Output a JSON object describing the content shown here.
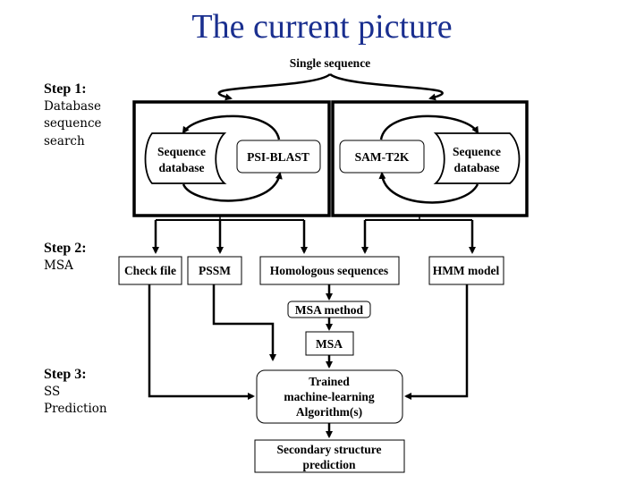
{
  "title": "The current picture",
  "steps": [
    {
      "heading": "Step 1:",
      "lines": [
        "Database",
        "sequence",
        "search"
      ]
    },
    {
      "heading": "Step 2:",
      "lines": [
        "MSA"
      ]
    },
    {
      "heading": "Step 3:",
      "lines": [
        "SS",
        "Prediction"
      ]
    }
  ],
  "diagram": {
    "input": "Single sequence",
    "left_panel": {
      "database": [
        "Sequence",
        "database"
      ],
      "tool": "PSI-BLAST"
    },
    "right_panel": {
      "tool": "SAM-T2K",
      "database": [
        "Sequence",
        "database"
      ]
    },
    "outputs": {
      "check_file": "Check file",
      "pssm": "PSSM",
      "homologous": "Homologous sequences",
      "hmm": "HMM model"
    },
    "msa_method": "MSA method",
    "msa": "MSA",
    "algorithm": [
      "Trained",
      "machine-learning",
      "Algorithm(s)"
    ],
    "result": [
      "Secondary structure",
      "prediction"
    ]
  },
  "colors": {
    "title": "#1a2f8f",
    "stroke": "#000000"
  }
}
